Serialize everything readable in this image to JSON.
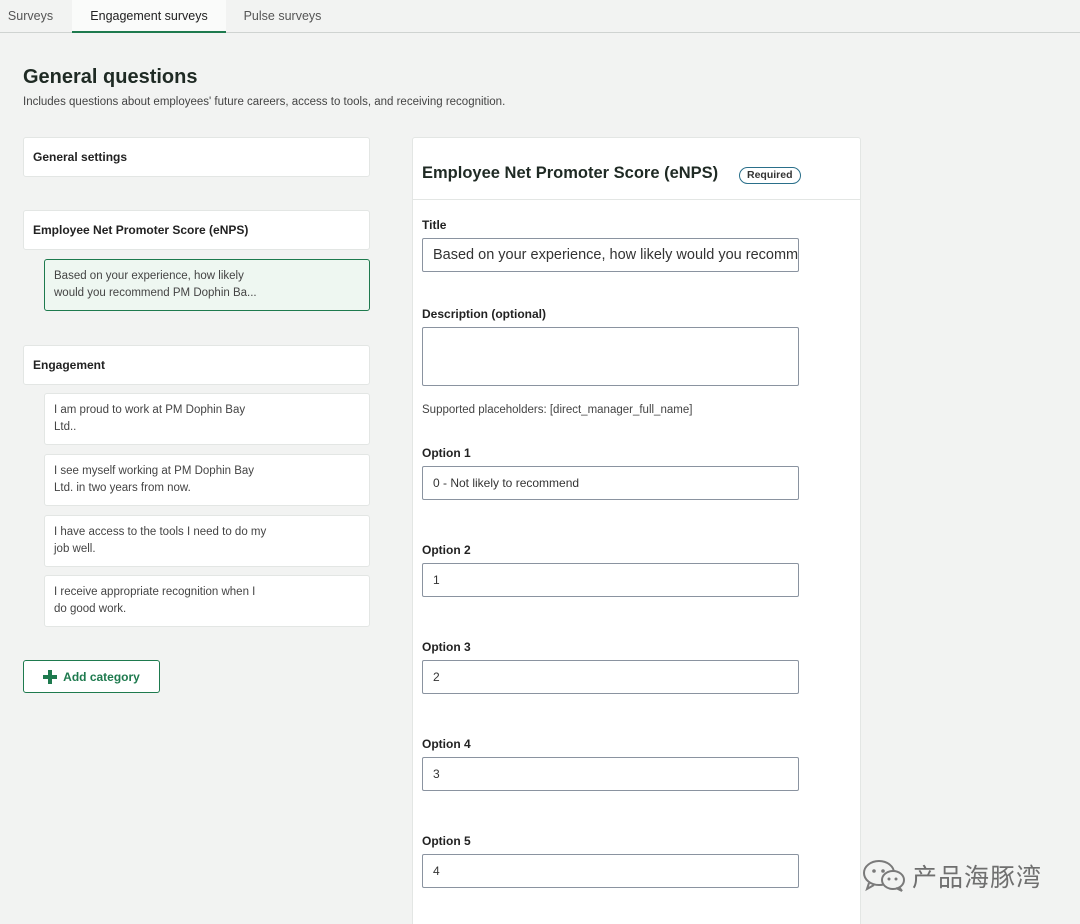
{
  "tabs": [
    {
      "label": "Surveys"
    },
    {
      "label": "Engagement surveys"
    },
    {
      "label": "Pulse surveys"
    }
  ],
  "page": {
    "title": "General questions",
    "subtitle": "Includes questions about employees' future careers, access to tools, and receiving recognition."
  },
  "sidebar": {
    "general_settings": "General settings",
    "categories": [
      {
        "label": "Employee Net Promoter Score (eNPS)",
        "questions": [
          {
            "line1": "Based on your experience, how likely",
            "line2": "would you recommend PM Dophin Ba..."
          }
        ]
      },
      {
        "label": "Engagement",
        "questions": [
          {
            "line1": "I am proud to work at PM Dophin Bay",
            "line2": "Ltd.."
          },
          {
            "line1": "I see myself working at PM Dophin Bay",
            "line2": "Ltd. in two years from now."
          },
          {
            "line1": "I have access to the tools I need to do my",
            "line2": "job well."
          },
          {
            "line1": "I receive appropriate recognition when I",
            "line2": "do good work."
          }
        ]
      }
    ],
    "add_category": "Add category"
  },
  "editor": {
    "title": "Employee Net Promoter Score (eNPS)",
    "badge": "Required",
    "title_label": "Title",
    "title_value": "Based on your experience, how likely would you recomm",
    "description_label": "Description (optional)",
    "description_value": "",
    "helper": "Supported placeholders: [direct_manager_full_name]",
    "options": [
      {
        "label": "Option 1",
        "value": "0 - Not likely to recommend"
      },
      {
        "label": "Option 2",
        "value": "1"
      },
      {
        "label": "Option 3",
        "value": "2"
      },
      {
        "label": "Option 4",
        "value": "3"
      },
      {
        "label": "Option 5",
        "value": "4"
      }
    ]
  },
  "watermark": {
    "text": "产品海豚湾",
    "icon": "wechat-icon"
  },
  "colors": {
    "accent": "#1e7a4e",
    "badge_border": "#2a6f8a",
    "background": "#f2f3f2"
  }
}
